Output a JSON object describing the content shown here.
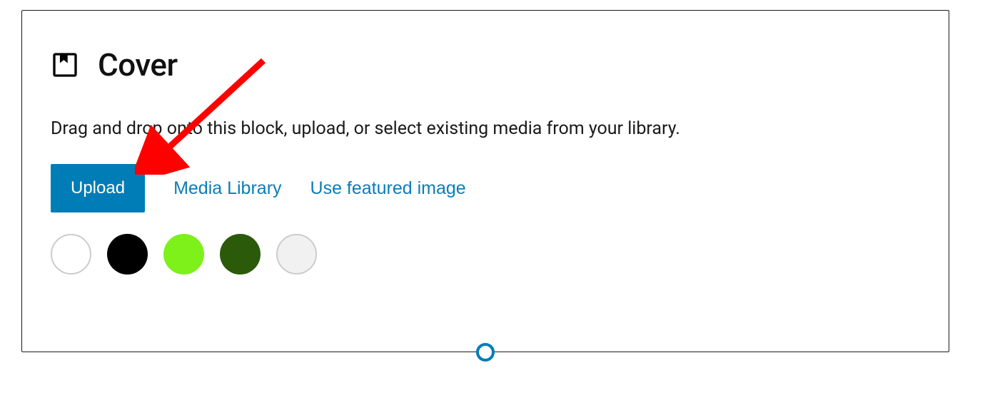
{
  "block": {
    "title": "Cover",
    "instructions": "Drag and drop onto this block, upload, or select existing media from your library.",
    "actions": {
      "upload": "Upload",
      "media_library": "Media Library",
      "featured_image": "Use featured image"
    },
    "colors": [
      {
        "name": "white",
        "value": "#ffffff",
        "outlined": true
      },
      {
        "name": "black",
        "value": "#000000",
        "outlined": false
      },
      {
        "name": "lime",
        "value": "#7ef01a",
        "outlined": false
      },
      {
        "name": "dark-green",
        "value": "#2b5a0b",
        "outlined": false
      },
      {
        "name": "light-gray",
        "value": "#f1f1f1",
        "outlined": true
      }
    ],
    "annotation": {
      "arrow_color": "#ff0000"
    }
  }
}
